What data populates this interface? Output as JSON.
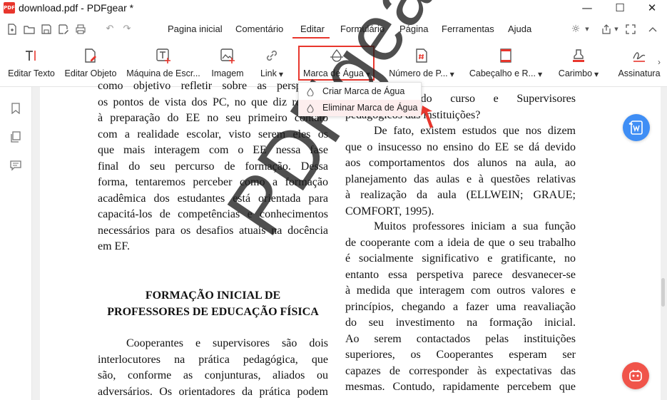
{
  "window": {
    "title": "download.pdf - PDFgear *",
    "logo_text": "PDF",
    "controls": [
      "minimize-icon",
      "maximize-icon",
      "close-icon"
    ]
  },
  "quickbar": {
    "icons": [
      "new-file-icon",
      "open-folder-icon",
      "save-icon",
      "save-as-icon",
      "print-icon",
      "undo-icon",
      "redo-icon"
    ]
  },
  "menu": {
    "items": [
      "Pagina inicial",
      "Comentário",
      "Editar",
      "Formulário",
      "Página",
      "Ferramentas",
      "Ajuda"
    ],
    "active": "Editar"
  },
  "right_tools": [
    "theme-icon",
    "share-icon",
    "fullscreen-icon",
    "collapse-ribbon-icon"
  ],
  "ribbon": {
    "tools": [
      {
        "label": "Editar Texto",
        "icon": "edit-text-icon"
      },
      {
        "label": "Editar Objeto",
        "icon": "edit-object-icon"
      },
      {
        "label": "Máquina de Escr...",
        "icon": "typewriter-icon"
      },
      {
        "label": "Imagem",
        "icon": "image-icon"
      },
      {
        "label": "Link",
        "icon": "link-icon",
        "dropdown": true
      },
      {
        "label": "Marca de Água",
        "icon": "watermark-icon",
        "dropdown": true
      },
      {
        "label": "Número de P...",
        "icon": "page-number-icon",
        "dropdown": true
      },
      {
        "label": "Cabeçalho e R...",
        "icon": "header-footer-icon",
        "dropdown": true
      },
      {
        "label": "Carimbo",
        "icon": "stamp-icon",
        "dropdown": true
      },
      {
        "label": "Assinatura",
        "icon": "signature-icon"
      }
    ]
  },
  "dropdown": {
    "items": [
      {
        "label": "Criar Marca de Água",
        "icon": "water-drop-icon"
      },
      {
        "label": "Eliminar Marca de Água",
        "icon": "water-drop-icon"
      }
    ],
    "hovered": "Eliminar Marca de Água"
  },
  "sidebar": {
    "icons": [
      "bookmark-icon",
      "thumbnails-icon",
      "comments-icon"
    ]
  },
  "document": {
    "left_column": [
      "como objetivo refletir sobre as perspetivas",
      "os pontos de vista dos PC, no que diz respeito",
      "à preparação do EE no seu primeiro contato",
      "com a realidade escolar, visto serem eles os",
      "que mais interagem com o EE nessa fase",
      "final do seu percurso de formação. Dessa",
      "forma, tentaremos perceber como a formação",
      "acadêmica dos estudantes está orientada para",
      "capacitá-los de competências e conhecimentos",
      "necessários para os desafios atuais na docência",
      "em EF."
    ],
    "heading": [
      "FORMAÇÃO INICIAL DE",
      "PROFESSORES DE EDUCAÇÃO FÍSICA"
    ],
    "left_column_2": [
      "Cooperantes e supervisores são dois",
      "interlocutores na prática pedagógica, que",
      "são, conforme as conjunturas, aliados ou",
      "adversários. Os orientadores da prática podem"
    ],
    "right_column": [
      "Cooperantes do curso e Supervisores",
      "pedagógicos das instituições?"
    ],
    "right_column_2": [
      "De fato, existem estudos que nos dizem",
      "que o insucesso no ensino do EE se dá devido",
      "aos comportamentos dos alunos na aula, ao",
      "planejamento das aulas e à questões relativas",
      "à realização da aula (ELLWEIN; GRAUE;",
      "COMFORT, 1995)."
    ],
    "right_column_3": [
      "Muitos professores iniciam a sua função",
      "de cooperante com a ideia de que o seu trabalho",
      "é socialmente significativo e gratificante, no",
      "entanto essa perspetiva parece desvanecer-se",
      "à medida que interagem com outros valores e",
      "princípios, chegando a fazer uma reavaliação",
      "do seu investimento na formação inicial.",
      "Ao serem contactados pelas instituições",
      "superiores, os Cooperantes esperam ser",
      "capazes de corresponder às expectativas das",
      "mesmas. Contudo, rapidamente percebem que"
    ],
    "watermark": "PDFgear"
  },
  "floating": [
    "convert-to-word-icon",
    "assistant-bot-icon"
  ],
  "colors": {
    "accent": "#e8362d",
    "convert_button": "#3f8ef5",
    "assistant_button": "#f0544a"
  }
}
